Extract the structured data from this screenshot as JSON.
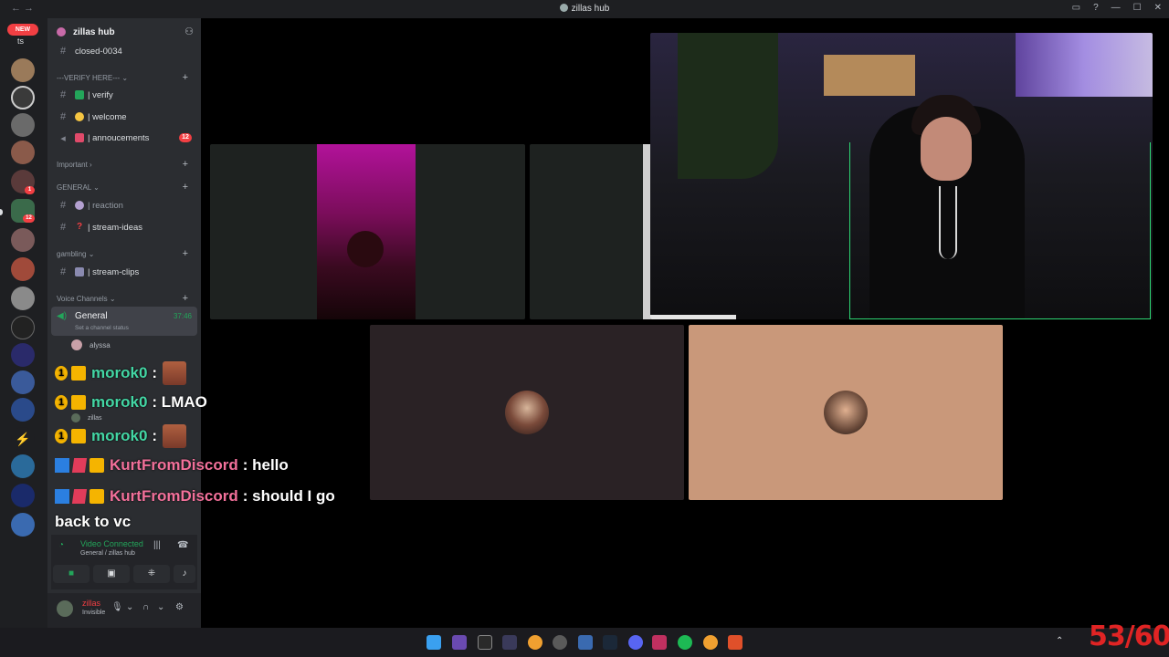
{
  "window": {
    "title": "zillas hub"
  },
  "rail": {
    "new_badge": "NEW",
    "top_label": "ts",
    "badges": [
      "1",
      "12"
    ]
  },
  "sidebar": {
    "server_name": "zillas hub",
    "channels_top": [
      {
        "label": "closed-0034"
      }
    ],
    "categories": {
      "verify": "---VERIFY HERE---",
      "important": "Important",
      "general": "GENERAL",
      "gambling": "gambling",
      "voice": "Voice Channels"
    },
    "verify_channels": [
      {
        "label": "| verify"
      },
      {
        "label": "| welcome"
      },
      {
        "label": "| annoucements",
        "badge": "12"
      }
    ],
    "general_channels": [
      {
        "label": "| reaction"
      },
      {
        "label": "| stream-ideas"
      }
    ],
    "gambling_channels": [
      {
        "label": "| stream-clips"
      }
    ],
    "voice_channel": {
      "label": "General",
      "timer": "37:46",
      "status": "Set a channel status"
    },
    "voice_users": [
      "alyssa",
      "zillas"
    ],
    "voice_panel": {
      "connected": "Video Connected",
      "location": "General / zillas hub"
    },
    "user": {
      "name": "zillas",
      "status": "Invisible"
    }
  },
  "chat": [
    {
      "user": "morok0",
      "text": ":",
      "color": "green"
    },
    {
      "user": "morok0",
      "text": ": LMAO",
      "color": "green"
    },
    {
      "user": "morok0",
      "text": ":",
      "color": "green"
    },
    {
      "user": "KurtFromDiscord",
      "text": ": hello",
      "color": "pink"
    },
    {
      "user": "KurtFromDiscord",
      "text": ": should I go",
      "color": "pink"
    }
  ],
  "chat_wrap": "back to vc",
  "fps_overlay": "53/60",
  "colors": {
    "accent_green": "#23a55a",
    "danger": "#f23f43",
    "chat_green": "#43d6a4",
    "chat_pink": "#f2709a"
  }
}
